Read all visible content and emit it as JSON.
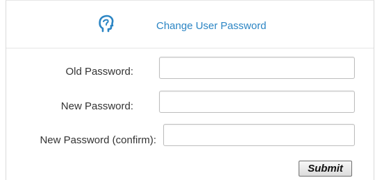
{
  "header": {
    "title": "Change User Password",
    "icon": "user-head-icon",
    "accent_color": "#2b85c4"
  },
  "form": {
    "old_password": {
      "label": "Old Password:",
      "value": ""
    },
    "new_password": {
      "label": "New Password:",
      "value": ""
    },
    "confirm_password": {
      "label": "New Password (confirm):",
      "value": ""
    },
    "submit_label": "Submit"
  }
}
